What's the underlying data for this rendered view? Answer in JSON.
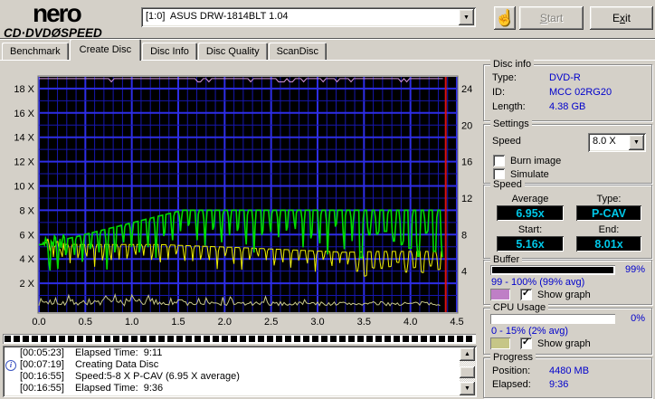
{
  "app": {
    "logo_line1": "nero",
    "logo_cd_dvd": "CD·DVD",
    "logo_glyph": "Ø",
    "logo_speed": "SPEED",
    "drive_selector_value": "[1:0]  ASUS DRW-1814BLT 1.04",
    "start_button": {
      "text": "Start",
      "ul": "S"
    },
    "exit_button": {
      "text": "Exit",
      "ul": "x"
    }
  },
  "tabs": {
    "items": [
      {
        "label": "Benchmark",
        "active": false
      },
      {
        "label": "Create Disc",
        "active": true
      },
      {
        "label": "Disc Info",
        "active": false
      },
      {
        "label": "Disc Quality",
        "active": false
      },
      {
        "label": "ScanDisc",
        "active": false
      }
    ]
  },
  "chart_data": {
    "type": "line",
    "title": "",
    "x_axis": {
      "range": [
        0,
        4.5
      ],
      "ticks": [
        "0.0",
        "0.5",
        "1.0",
        "1.5",
        "2.0",
        "2.5",
        "3.0",
        "3.5",
        "4.0",
        "4.5"
      ],
      "unit": "GB"
    },
    "left_axis": {
      "ticks": [
        2,
        4,
        6,
        8,
        10,
        12,
        14,
        16,
        18
      ],
      "suffix": " X",
      "range": [
        0,
        18.96
      ]
    },
    "right_axis": {
      "ticks": [
        4,
        8,
        12,
        16,
        20,
        24
      ],
      "range": [
        0,
        25.28
      ]
    },
    "grid": {
      "minor_x_step": 0.1,
      "major_x_step": 0.5,
      "minor_y_step": 1,
      "major_y_step": 2,
      "bg": "#000000",
      "minor_color": "#1717ad",
      "major_color": "#2e2ee6"
    },
    "end_marker": {
      "x": 4.38,
      "color": "#dd1111"
    },
    "data_end_x": 4.35,
    "series": [
      {
        "name": "buffer-level",
        "color": "#d092dc",
        "base_value": 18.82,
        "dip_value": 18.55,
        "note": "buffer 99-100%"
      },
      {
        "name": "cpu-usage",
        "color": "#c8c88a",
        "base": 0.16,
        "amp_early": 0.6,
        "amp_late": 0.33,
        "note": "cpu 0-15%, 2% avg"
      },
      {
        "name": "secondary-speed",
        "color": "#f0f000",
        "envelope": [
          [
            0,
            5.2
          ],
          [
            1.3,
            5.18
          ],
          [
            2.2,
            4.92
          ],
          [
            3.3,
            4.55
          ],
          [
            3.65,
            4.62
          ],
          [
            4.35,
            4.62
          ]
        ],
        "dips": {
          "start": 0.145,
          "period": 0.088,
          "depth": 1.55,
          "width": 0.03
        }
      },
      {
        "name": "write-speed",
        "color": "#00dc00",
        "envelope": [
          [
            0,
            5.16
          ],
          [
            0.12,
            5.3
          ],
          [
            1.55,
            8.01
          ],
          [
            4.35,
            8.01
          ]
        ],
        "dips": {
          "start": 0.1,
          "period": 0.088,
          "depth": 3.1,
          "width": 0.034
        },
        "key_values": {
          "start": 5.16,
          "end": 8.01,
          "average": 6.95
        }
      }
    ]
  },
  "disc_info": {
    "title": "Disc info",
    "type_label": "Type:",
    "type": "DVD-R",
    "id_label": "ID:",
    "id": "MCC 02RG20",
    "length_label": "Length:",
    "length": "4.38 GB"
  },
  "settings": {
    "title": "Settings",
    "speed_label": "Speed",
    "speed_value": "8.0 X",
    "burn_image_label": "Burn image",
    "simulate_label": "Simulate"
  },
  "speed": {
    "title": "Speed",
    "average_label": "Average",
    "average": "6.95x",
    "type_label": "Type:",
    "type": "P-CAV",
    "start_label": "Start:",
    "start": "5.16x",
    "end_label": "End:",
    "end": "8.01x"
  },
  "buffer": {
    "title": "Buffer",
    "percent": "99%",
    "fill_percent": 97,
    "range": "99 - 100% (99% avg)",
    "show_graph_label": "Show graph",
    "graph_color": "#bf7fc6",
    "checked": true
  },
  "cpu": {
    "title": "CPU Usage",
    "percent": "0%",
    "fill_percent": 0,
    "range": "0 - 15% (2% avg)",
    "show_graph_label": "Show graph",
    "graph_color": "#c6c687",
    "checked": true
  },
  "progress": {
    "title": "Progress",
    "position_label": "Position:",
    "position": "4480 MB",
    "elapsed_label": "Elapsed:",
    "elapsed": "9:36"
  },
  "log": {
    "lines": [
      {
        "time": "[00:05:23]",
        "text": "Elapsed Time:  9:11",
        "icon": false
      },
      {
        "time": "[00:07:19]",
        "text": "Creating Data Disc",
        "icon": true
      },
      {
        "time": "[00:16:55]",
        "text": "Speed:5-8 X P-CAV (6.95 X average)",
        "icon": false
      },
      {
        "time": "[00:16:55]",
        "text": "Elapsed Time:  9:36",
        "icon": false
      }
    ]
  }
}
